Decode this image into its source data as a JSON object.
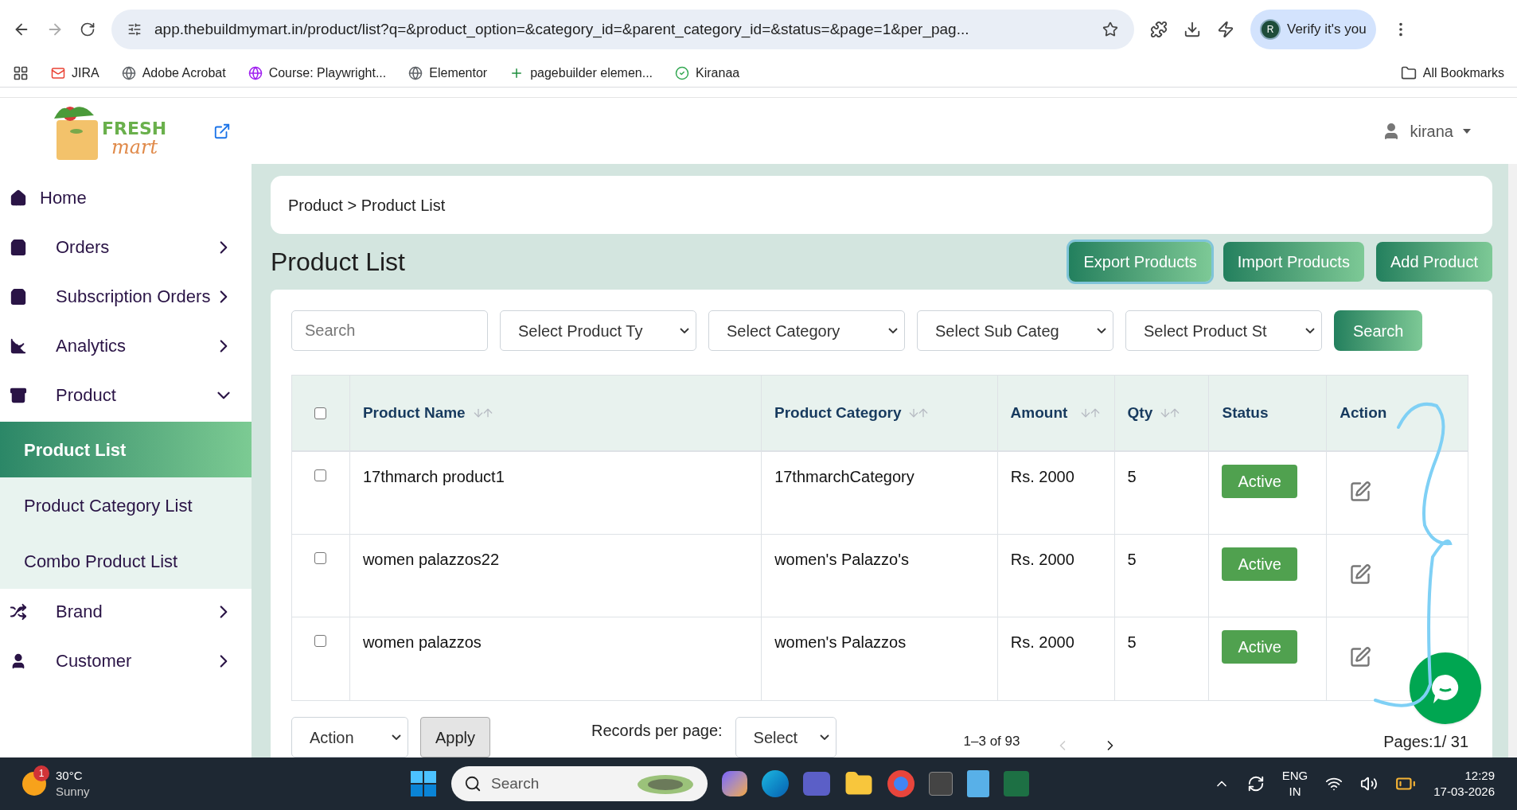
{
  "browser": {
    "url": "app.thebuildmymart.in/product/list?q=&product_option=&category_id=&parent_category_id=&status=&page=1&per_pag...",
    "profile_button": "Verify it's you",
    "profile_initial": "R",
    "bookmarks": [
      "JIRA",
      "Adobe Acrobat",
      "Course: Playwright...",
      "Elementor",
      "pagebuilder elemen...",
      "Kiranaa"
    ],
    "all_bookmarks": "All Bookmarks"
  },
  "header": {
    "logo_top": "FRESH",
    "logo_bottom": "mart",
    "user": "kirana"
  },
  "sidebar": {
    "items": [
      {
        "label": "Home",
        "has_submenu": false
      },
      {
        "label": "Orders",
        "has_submenu": true,
        "expanded": false
      },
      {
        "label": "Subscription Orders",
        "has_submenu": true,
        "expanded": false
      },
      {
        "label": "Analytics",
        "has_submenu": true,
        "expanded": false
      },
      {
        "label": "Product",
        "has_submenu": true,
        "expanded": true,
        "children": [
          {
            "label": "Product List",
            "selected": true
          },
          {
            "label": "Product Category List",
            "selected": false
          },
          {
            "label": "Combo Product List",
            "selected": false
          }
        ]
      },
      {
        "label": "Brand",
        "has_submenu": true,
        "expanded": false
      },
      {
        "label": "Customer",
        "has_submenu": true,
        "expanded": false
      }
    ]
  },
  "breadcrumb": "Product > Product List",
  "title": "Product List",
  "actions": [
    {
      "label": "Export Products",
      "focused": true
    },
    {
      "label": "Import Products",
      "focused": false
    },
    {
      "label": "Add Product",
      "focused": false
    }
  ],
  "filters": [
    {
      "kind": "text",
      "placeholder": "Search"
    },
    {
      "kind": "select",
      "value": "Select Product Ty"
    },
    {
      "kind": "select",
      "value": "Select Category"
    },
    {
      "kind": "select",
      "value": "Select Sub Categ"
    },
    {
      "kind": "select",
      "value": "Select Product St"
    }
  ],
  "search_button": "Search",
  "table": {
    "select_all_checked": false,
    "columns": [
      {
        "label": "Product Name",
        "sortable": true
      },
      {
        "label": "Product Category",
        "sortable": true
      },
      {
        "label": "Amount",
        "sortable": true
      },
      {
        "label": "Qty",
        "sortable": true
      },
      {
        "label": "Status",
        "sortable": false
      },
      {
        "label": "Action",
        "sortable": false
      }
    ],
    "rows": [
      {
        "checked": false,
        "name": "17thmarch product1",
        "category": "17thmarchCategory",
        "amount": "Rs. 2000",
        "qty": "5",
        "status": "Active"
      },
      {
        "checked": false,
        "name": "women palazzos22",
        "category": "women's Palazzo's",
        "amount": "Rs. 2000",
        "qty": "5",
        "status": "Active"
      },
      {
        "checked": false,
        "name": "women palazzos",
        "category": "women's Palazzos",
        "amount": "Rs. 2000",
        "qty": "5",
        "status": "Active"
      }
    ]
  },
  "footer": {
    "bulk_action": "Action",
    "apply": "Apply",
    "records_label": "Records per page:",
    "records_value": "Select",
    "range": "1–3 of 93",
    "pages": "Pages:1/ 31"
  },
  "taskbar": {
    "weather_badge": "1",
    "temperature": "30°C",
    "weather": "Sunny",
    "search_placeholder": "Search",
    "language": "ENG",
    "region": "IN",
    "time": "12:29",
    "date": "17-03-2026"
  }
}
